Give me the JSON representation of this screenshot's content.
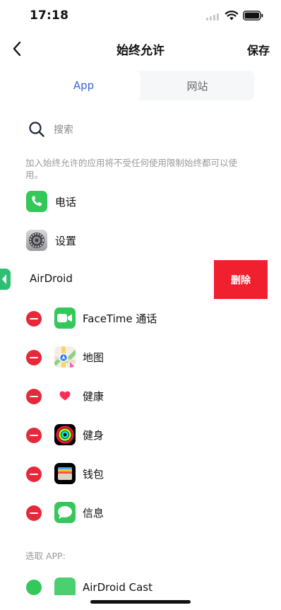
{
  "status_bar": {
    "time": "17:18"
  },
  "nav": {
    "title": "始终允许",
    "save_label": "保存"
  },
  "tabs": [
    {
      "label": "App",
      "active": true
    },
    {
      "label": "网站",
      "active": false
    }
  ],
  "search": {
    "placeholder": "搜索"
  },
  "hint": "加入始终允许的应用将不受任何使用限制始终都可以使用。",
  "default_apps": [
    {
      "name": "电话",
      "icon": "phone-icon"
    },
    {
      "name": "设置",
      "icon": "settings-icon"
    }
  ],
  "swiped_app": {
    "name": "AirDroid",
    "delete_label": "删除"
  },
  "removable_apps": [
    {
      "name": "FaceTime 通话",
      "icon": "facetime-icon"
    },
    {
      "name": "地图",
      "icon": "maps-icon"
    },
    {
      "name": "健康",
      "icon": "health-icon"
    },
    {
      "name": "健身",
      "icon": "fitness-icon"
    },
    {
      "name": "钱包",
      "icon": "wallet-icon"
    },
    {
      "name": "信息",
      "icon": "messages-icon"
    }
  ],
  "select_section_label": "选取 APP:",
  "partial_app": {
    "name": "AirDroid Cast"
  },
  "colors": {
    "accent": "#3a63d6",
    "delete": "#f0202e",
    "remove": "#e6283a"
  }
}
